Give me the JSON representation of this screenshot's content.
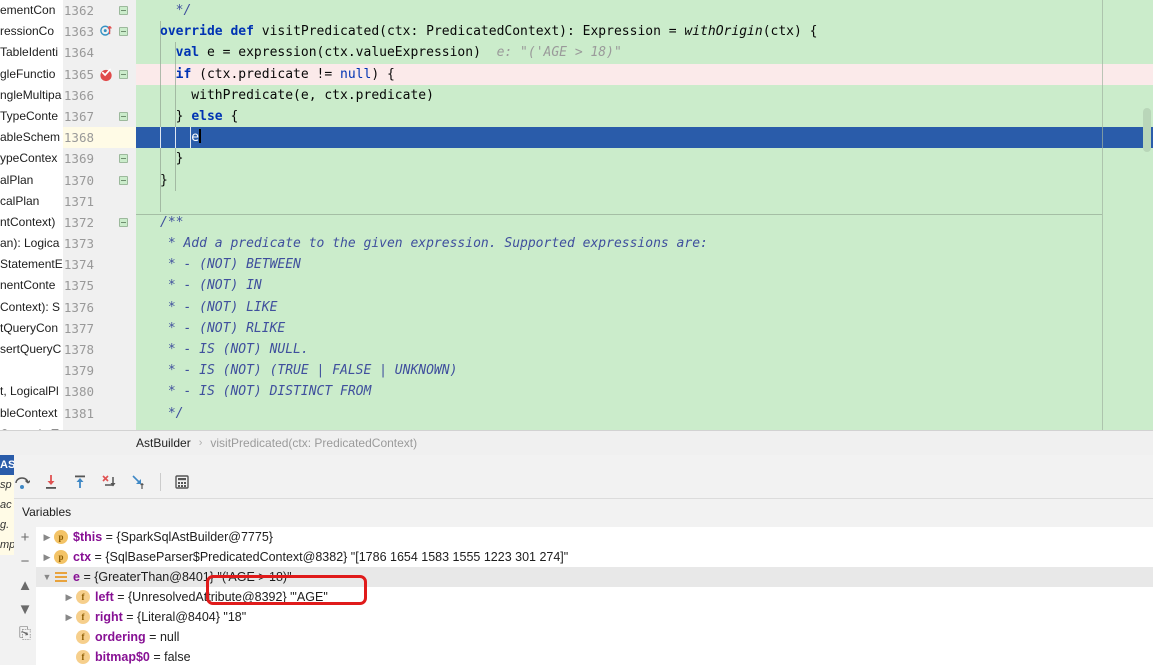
{
  "editor": {
    "margin_guide_column": 1102,
    "lines": [
      {
        "num": "1362",
        "fold": true,
        "marker": null,
        "html": "  <c>*/</c>"
      },
      {
        "num": "1363",
        "fold": true,
        "marker": "override",
        "html": "<k>override</k> <k>def</k> visitPredicated(ctx: PredicatedContext): Expression = <i>withOrigin</i>(ctx) {"
      },
      {
        "num": "1364",
        "fold": false,
        "marker": null,
        "html": "  <k>val</k> e = expression(ctx.valueExpression)  <h>e: \"('AGE &gt; 18)\"</h>"
      },
      {
        "num": "1365",
        "fold": true,
        "marker": "breakpoint",
        "warn": true,
        "html": "  <k>if</k> (ctx.predicate != <k2>null</k>) {"
      },
      {
        "num": "1366",
        "fold": false,
        "marker": null,
        "html": "    withPredicate(e, ctx.predicate)"
      },
      {
        "num": "1367",
        "fold": true,
        "marker": null,
        "html": "  } <k>else</k> {"
      },
      {
        "num": "1368",
        "fold": false,
        "marker": null,
        "selected": true,
        "current": true,
        "html": "    e"
      },
      {
        "num": "1369",
        "fold": true,
        "marker": null,
        "html": "  }"
      },
      {
        "num": "1370",
        "fold": true,
        "marker": null,
        "html": "}"
      },
      {
        "num": "1371",
        "fold": false,
        "marker": null,
        "html": ""
      },
      {
        "num": "1372",
        "fold": true,
        "marker": null,
        "html": "<c>/**</c>"
      },
      {
        "num": "1373",
        "fold": false,
        "marker": null,
        "html": " <c>* Add a predicate to the given expression. Supported expressions are:</c>"
      },
      {
        "num": "1374",
        "fold": false,
        "marker": null,
        "html": " <c>* - (NOT) BETWEEN</c>"
      },
      {
        "num": "1375",
        "fold": false,
        "marker": null,
        "html": " <c>* - (NOT) IN</c>"
      },
      {
        "num": "1376",
        "fold": false,
        "marker": null,
        "html": " <c>* - (NOT) LIKE</c>"
      },
      {
        "num": "1377",
        "fold": false,
        "marker": null,
        "html": " <c>* - (NOT) RLIKE</c>"
      },
      {
        "num": "1378",
        "fold": false,
        "marker": null,
        "html": " <c>* - IS (NOT) NULL.</c>"
      },
      {
        "num": "1379",
        "fold": false,
        "marker": null,
        "html": " <c>* - IS (NOT) (TRUE | FALSE | UNKNOWN)</c>"
      },
      {
        "num": "1380",
        "fold": false,
        "marker": null,
        "html": " <c>* - IS (NOT) DISTINCT FROM</c>"
      },
      {
        "num": "1381",
        "fold": false,
        "marker": null,
        "html": " <c>*/</c>"
      }
    ]
  },
  "structure_stub": {
    "rows": [
      "ementCon",
      "ressionCo",
      "TableIdenti",
      "gleFunctio",
      "ngleMultipa",
      "TypeConte",
      "ableSchem",
      "ypeContex",
      "alPlan",
      "calPlan",
      "ntContext)",
      "an): Logica",
      "StatementE",
      "nentConte",
      "Context): S",
      "tQueryCon",
      "sertQueryC",
      "",
      "t, LogicalPl",
      "bleContext",
      "OverwriteT"
    ]
  },
  "breadcrumb": {
    "class_name": "AstBuilder",
    "separator": "›",
    "method_name": "visitPredicated(ctx: PredicatedContext)"
  },
  "debugger": {
    "toolbar_buttons": [
      {
        "name": "step-over-icon",
        "glyph": "step-over"
      },
      {
        "name": "step-into-icon",
        "glyph": "step-into"
      },
      {
        "name": "step-out-icon",
        "glyph": "step-out"
      },
      {
        "name": "force-step-into-icon",
        "glyph": "force-step-into"
      },
      {
        "name": "run-to-cursor-icon",
        "glyph": "run-to-cursor"
      },
      {
        "name": "evaluate-expression-icon",
        "glyph": "evaluate"
      }
    ],
    "tab_label": "Variables",
    "side_buttons": [
      {
        "name": "add-watch-button",
        "glyph": "+"
      },
      {
        "name": "remove-watch-button",
        "glyph": "−"
      },
      {
        "name": "move-up-button",
        "glyph": "▲"
      },
      {
        "name": "move-down-button",
        "glyph": "▼"
      },
      {
        "name": "copy-value-button",
        "glyph": "⎘"
      }
    ],
    "variables": [
      {
        "indent": 0,
        "twisty": "collapsed",
        "kind": "p",
        "name": "$this",
        "value": "= {SparkSqlAstBuilder@7775}",
        "extra": ""
      },
      {
        "indent": 0,
        "twisty": "collapsed",
        "kind": "p",
        "name": "ctx",
        "value": "= {SqlBaseParser$PredicatedContext@8382}",
        "extra": "\"[1786 1654 1583 1555 1223 301 274]\""
      },
      {
        "indent": 0,
        "twisty": "expanded",
        "kind": "bars",
        "name": "e",
        "value": "= {GreaterThan@8401}",
        "extra": "\"('AGE > 18)\"",
        "selected": true
      },
      {
        "indent": 1,
        "twisty": "collapsed",
        "kind": "f",
        "name": "left",
        "value": "= {UnresolvedAttribute@8392}",
        "extra": "\"'AGE\""
      },
      {
        "indent": 1,
        "twisty": "collapsed",
        "kind": "f",
        "name": "right",
        "value": "= {Literal@8404}",
        "extra": "\"18\""
      },
      {
        "indent": 1,
        "twisty": "none",
        "kind": "f",
        "name": "ordering",
        "value": "= null",
        "extra": ""
      },
      {
        "indent": 1,
        "twisty": "none",
        "kind": "f",
        "name": "bitmap$0",
        "value": "= false",
        "extra": ""
      }
    ]
  },
  "far_left_stub": {
    "rows": [
      "AS",
      "sp",
      "ac",
      "g.",
      "mp"
    ]
  },
  "colors": {
    "diff_added_green": "#cbeccb",
    "warn_pink": "#fbeaea",
    "selection_blue": "#2a5caa",
    "current_line_yellow": "#fffbe6",
    "annotation_red": "#e01b1b",
    "keyword_blue": "#0033b3",
    "comment_blue": "#3f4f9d",
    "var_name_purple": "#871094",
    "icon_orange": "#f3c366"
  }
}
